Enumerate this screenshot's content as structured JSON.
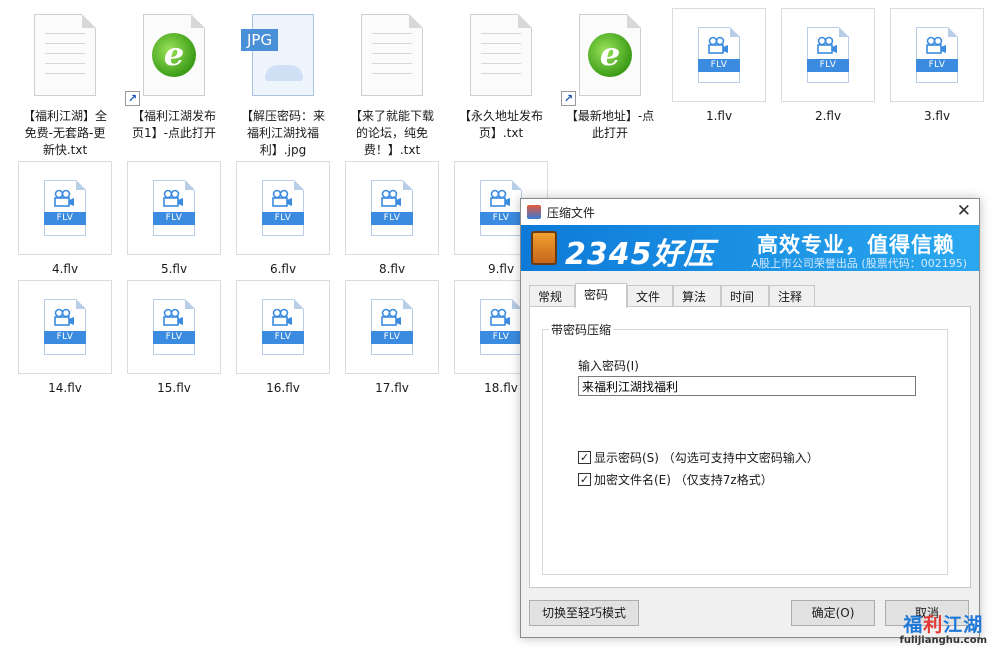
{
  "files": [
    {
      "name": "【福利江湖】全免费-无套路-更新快.txt",
      "type": "txt"
    },
    {
      "name": "【福利江湖发布页1】-点此打开",
      "type": "url"
    },
    {
      "name": "【解压密码：来福利江湖找福利】.jpg",
      "type": "jpg"
    },
    {
      "name": "【来了就能下载的论坛，纯免费！】.txt",
      "type": "txt"
    },
    {
      "name": "【永久地址发布页】.txt",
      "type": "txt"
    },
    {
      "name": "【最新地址】-点此打开",
      "type": "url"
    },
    {
      "name": "1.flv",
      "type": "flv"
    },
    {
      "name": "2.flv",
      "type": "flv"
    },
    {
      "name": "3.flv",
      "type": "flv"
    },
    {
      "name": "4.flv",
      "type": "flv"
    },
    {
      "name": "5.flv",
      "type": "flv"
    },
    {
      "name": "6.flv",
      "type": "flv"
    },
    {
      "name": "8.flv",
      "type": "flv"
    },
    {
      "name": "9.flv",
      "type": "flv"
    },
    {
      "name": "14.flv",
      "type": "flv"
    },
    {
      "name": "15.flv",
      "type": "flv"
    },
    {
      "name": "16.flv",
      "type": "flv"
    },
    {
      "name": "17.flv",
      "type": "flv"
    },
    {
      "name": "18.flv",
      "type": "flv"
    }
  ],
  "icons": {
    "jpg_tag": "JPG",
    "flv_band": "FLV",
    "ie_glyph": "e",
    "shortcut_glyph": "↗"
  },
  "dialog": {
    "title": "压缩文件",
    "close_glyph": "✕",
    "banner": {
      "logo": "2345好压",
      "slogan": "高效专业，值得信赖",
      "sub": "A股上市公司荣誉出品 (股票代码：002195)"
    },
    "tabs": [
      "常规",
      "密码",
      "文件",
      "算法",
      "时间",
      "注释"
    ],
    "active_tab": "密码",
    "group_title": "带密码压缩",
    "password_label": "输入密码(I)",
    "password_value": "来福利江湖找福利",
    "show_password": {
      "label": "显示密码(S) （勾选可支持中文密码输入）",
      "checked": true
    },
    "encrypt_names": {
      "label": "加密文件名(E) （仅支持7z格式）",
      "checked": true
    },
    "switch_button": "切换至轻巧模式",
    "ok_button": "确定(O)",
    "cancel_button": "取消"
  },
  "watermark": {
    "text_blue_1": "福",
    "text_red": "利",
    "text_blue_2": "江湖",
    "url": "fulijianghu.com"
  },
  "colors": {
    "banner": "#0d7ad8",
    "flv_blue": "#3b8be0",
    "ie_green": "#3c9c17"
  }
}
